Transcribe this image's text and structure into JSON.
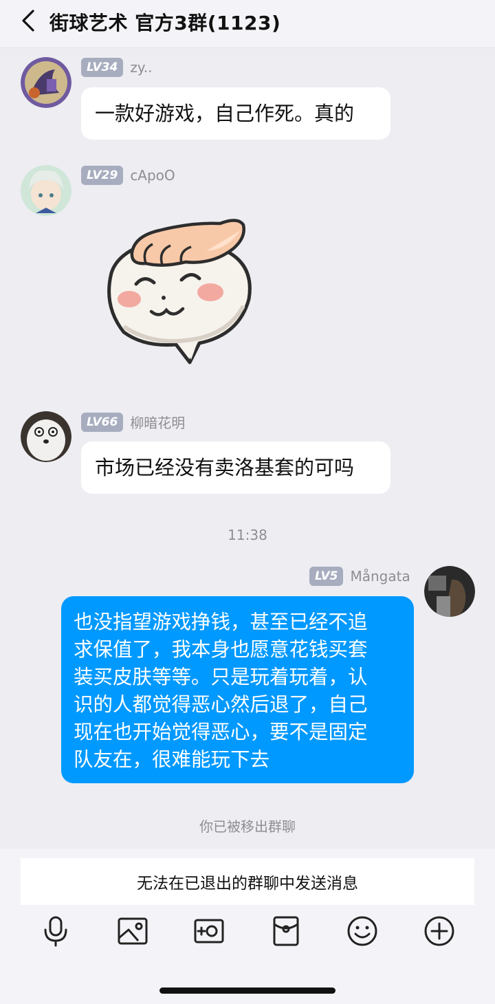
{
  "header": {
    "title": "街球艺术 官方3群(1123)"
  },
  "messages": [
    {
      "level": "LV34",
      "nick": "zy..",
      "text": "一款好游戏，自己作死。真的"
    },
    {
      "level": "LV29",
      "nick": "cApoO",
      "sticker": "steamed-bun-head-pat-sticker"
    },
    {
      "level": "LV66",
      "nick": "柳暗花明",
      "text": "市场已经没有卖洛基套的可吗"
    },
    {
      "level": "LV5",
      "nick": "Mångata",
      "lines": [
        "也没指望游戏挣钱，甚至已经不追",
        "求保值了，我本身也愿意花钱买套",
        "装买皮肤等等。只是玩着玩着，认",
        "识的人都觉得恶心然后退了，自己",
        "现在也开始觉得恶心，要不是固定",
        "队友在，很难能玩下去"
      ]
    }
  ],
  "timestamp": "11:38",
  "system_note": "你已被移出群聊",
  "input": {
    "disabled_text": "无法在已退出的群聊中发送消息"
  },
  "toolbar": [
    "microphone-icon",
    "image-icon",
    "camera-icon",
    "red-packet-icon",
    "emoji-icon",
    "plus-icon"
  ],
  "colors": {
    "own_bubble": "#0099ff",
    "level_badge": "#a7adbf",
    "background": "#ededf2"
  }
}
